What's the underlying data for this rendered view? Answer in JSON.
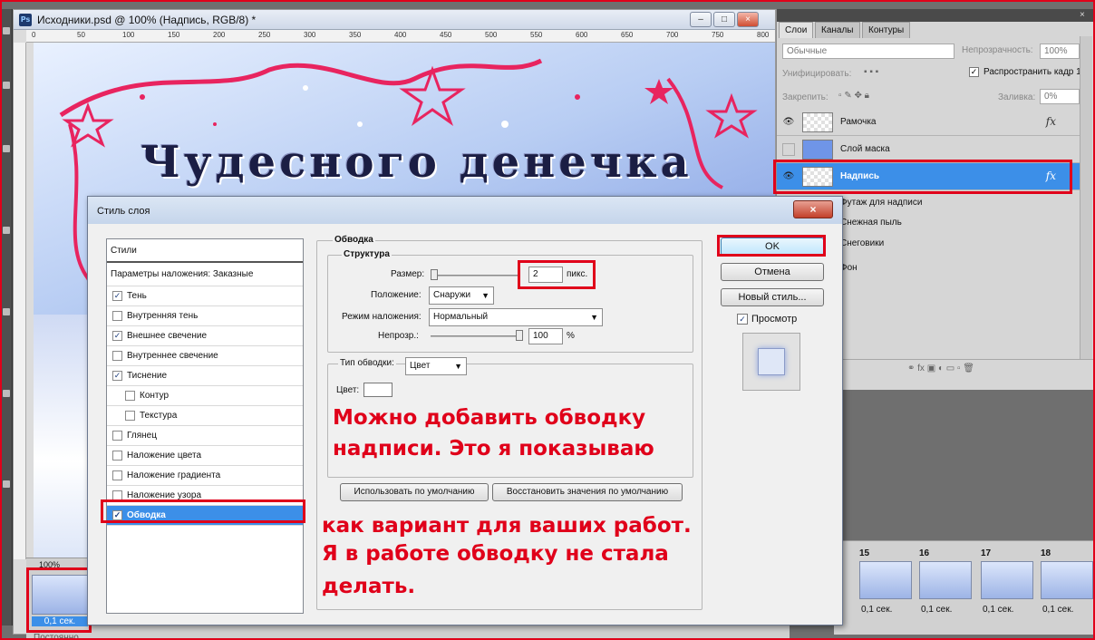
{
  "document": {
    "title": "Исходники.psd @ 100% (Надпись, RGB/8) *",
    "app_badge": "Ps",
    "ruler_marks": [
      "0",
      "50",
      "100",
      "150",
      "200",
      "250",
      "300",
      "350",
      "400",
      "450",
      "500",
      "550",
      "600",
      "650",
      "700",
      "750",
      "800"
    ],
    "canvas_text": "Чудесного денечка"
  },
  "window_buttons": {
    "minimize": "–",
    "maximize": "□",
    "close": "×"
  },
  "timeline": {
    "zoom": "100%",
    "frame_delay": "0,1 сек.",
    "loop": "Постоянно"
  },
  "layers_panel": {
    "tabs": [
      "Слои",
      "Каналы",
      "Контуры"
    ],
    "blend_mode": "Обычные",
    "opacity_label": "Непрозрачность:",
    "opacity_value": "100%",
    "unify_label": "Унифицировать:",
    "propagate_label": "Распространить кадр 1",
    "lock_label": "Закрепить:",
    "fill_label": "Заливка:",
    "fill_value": "0%",
    "layers": [
      {
        "name": "Рамочка",
        "fx": "fx"
      },
      {
        "name": "Слой маска"
      },
      {
        "name": "Надпись",
        "fx": "fx"
      }
    ],
    "sublayers": [
      "Футаж для надписи",
      "Снежная пыль",
      "Снеговики",
      "Фон"
    ]
  },
  "filmstrip": {
    "frames": [
      {
        "num": "15",
        "sec": "0,1 сек."
      },
      {
        "num": "16",
        "sec": "0,1 сек."
      },
      {
        "num": "17",
        "sec": "0,1 сек."
      },
      {
        "num": "18",
        "sec": "0,1 сек."
      }
    ]
  },
  "dialog": {
    "title": "Стиль слоя",
    "close": "×",
    "styles_header": "Стили",
    "blend_options": "Параметры наложения: Заказные",
    "styles": [
      {
        "label": "Тень",
        "checked": true,
        "indent": false
      },
      {
        "label": "Внутренняя тень",
        "checked": false,
        "indent": false
      },
      {
        "label": "Внешнее свечение",
        "checked": true,
        "indent": false
      },
      {
        "label": "Внутреннее свечение",
        "checked": false,
        "indent": false
      },
      {
        "label": "Тиснение",
        "checked": true,
        "indent": false
      },
      {
        "label": "Контур",
        "checked": false,
        "indent": true
      },
      {
        "label": "Текстура",
        "checked": false,
        "indent": true
      },
      {
        "label": "Глянец",
        "checked": false,
        "indent": false
      },
      {
        "label": "Наложение цвета",
        "checked": false,
        "indent": false
      },
      {
        "label": "Наложение градиента",
        "checked": false,
        "indent": false
      },
      {
        "label": "Наложение узора",
        "checked": false,
        "indent": false
      },
      {
        "label": "Обводка",
        "checked": true,
        "indent": false,
        "selected": true
      }
    ],
    "stroke_section": "Обводка",
    "structure_section": "Структура",
    "size_label": "Размер:",
    "size_value": "2",
    "size_unit": "пикс.",
    "position_label": "Положение:",
    "position_value": "Снаружи",
    "blend_mode_label": "Режим наложения:",
    "blend_mode_value": "Нормальный",
    "opacity_label": "Непрозр.:",
    "opacity_value": "100",
    "opacity_unit": "%",
    "fill_type_label": "Тип обводки:",
    "fill_type_value": "Цвет",
    "color_label": "Цвет:",
    "use_default": "Использовать по умолчанию",
    "reset_default": "Восстановить значения по умолчанию",
    "ok": "OK",
    "cancel": "Отмена",
    "new_style": "Новый стиль...",
    "preview_label": "Просмотр",
    "check_mark": "✓"
  },
  "annotation": {
    "line1": "Можно добавить обводку",
    "line2": "надписи. Это я показываю",
    "line3": "как вариант для ваших работ.",
    "line4": "Я в работе обводку не стала",
    "line5": "делать."
  },
  "colors": {
    "highlight": "#e0001a",
    "selection": "#3c8fe8",
    "annotation": "#e0001a"
  }
}
